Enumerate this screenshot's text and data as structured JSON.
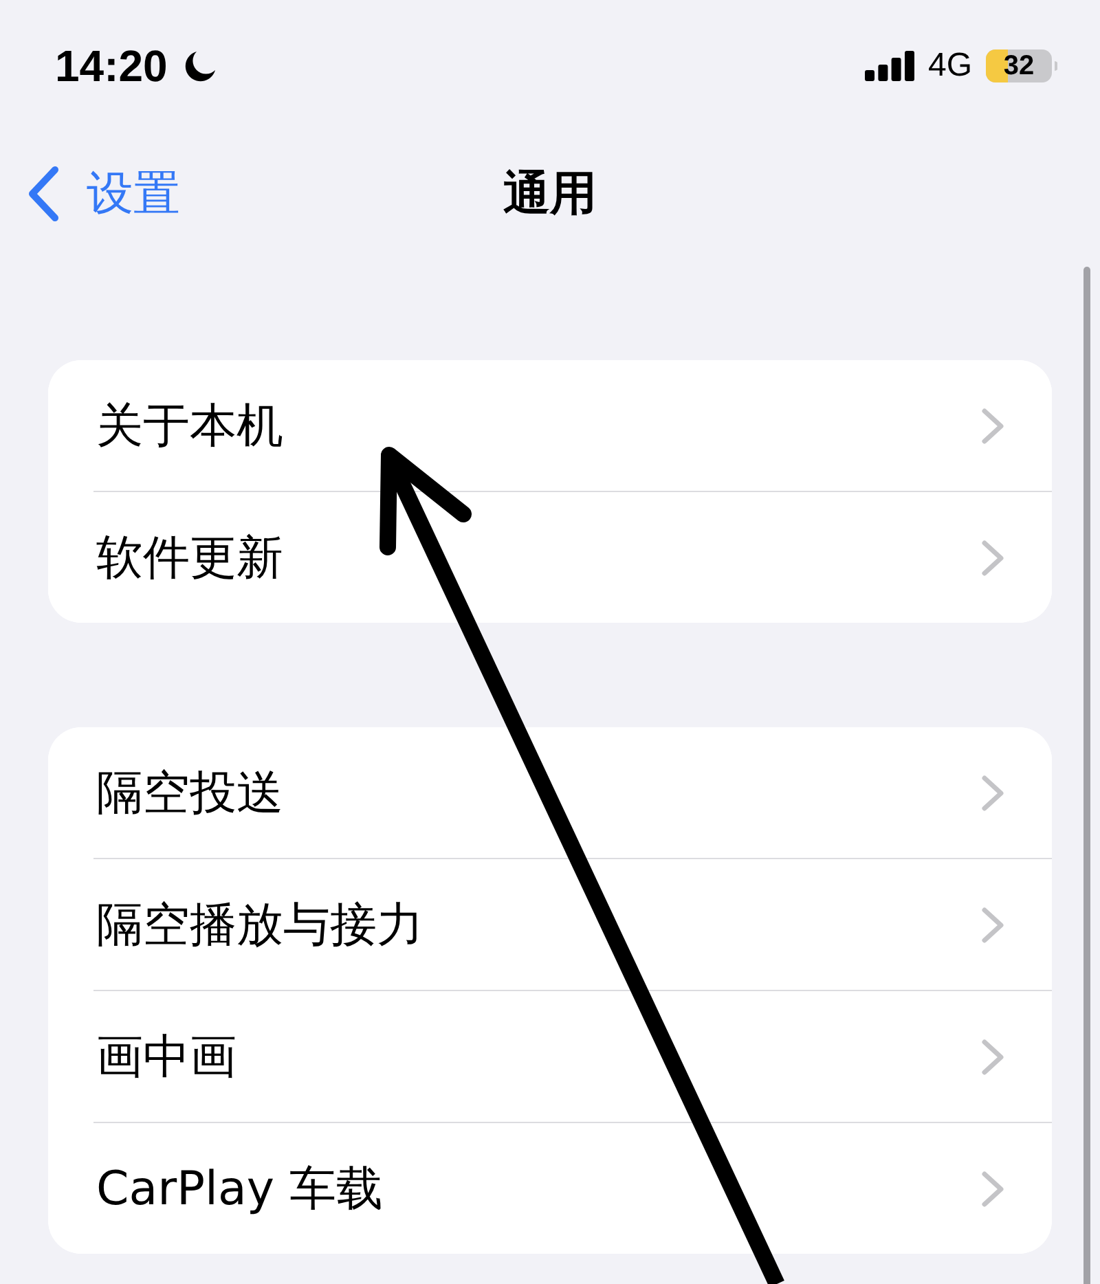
{
  "status_bar": {
    "time": "14:20",
    "network": "4G",
    "battery": "32",
    "low_power_mode": true
  },
  "nav_bar": {
    "back": "设置",
    "title": "通用"
  },
  "groups": [
    {
      "items": [
        {
          "label": "关于本机"
        },
        {
          "label": "软件更新"
        }
      ]
    },
    {
      "items": [
        {
          "label": "隔空投送"
        },
        {
          "label": "隔空播放与接力"
        },
        {
          "label": "画中画"
        },
        {
          "label": "CarPlay 车载"
        }
      ]
    }
  ]
}
